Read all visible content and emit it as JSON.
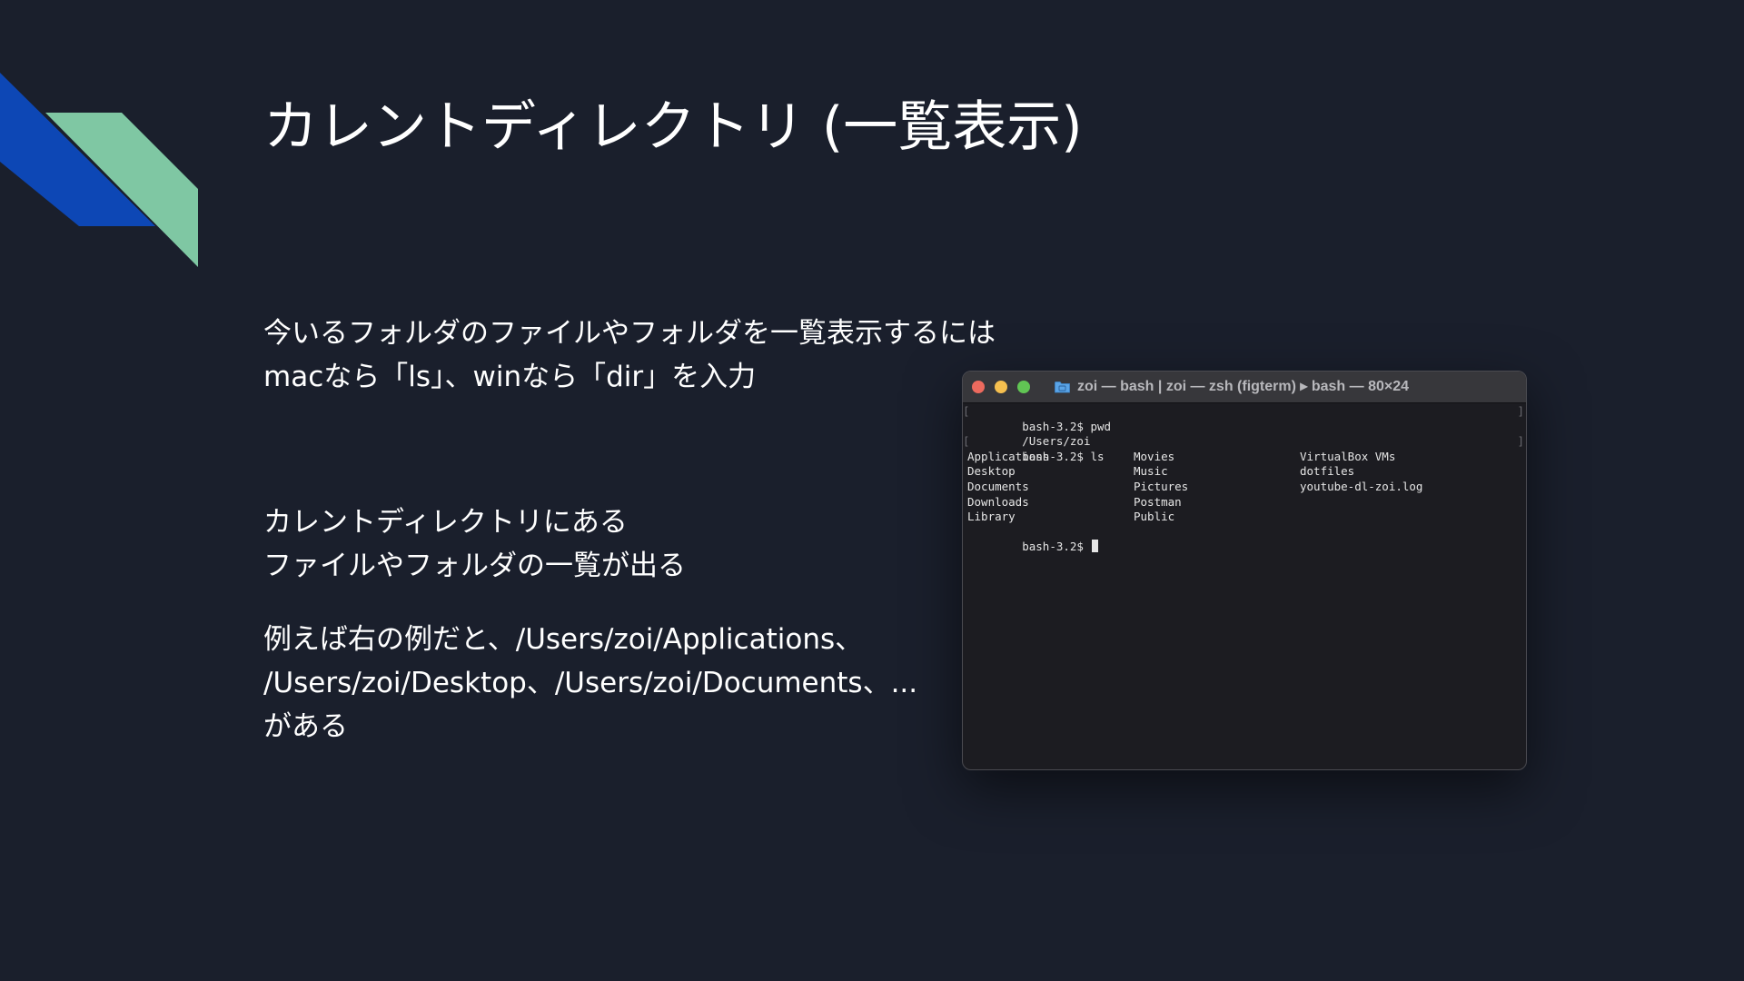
{
  "slide": {
    "title": "カレントディレクトリ (一覧表示)",
    "paragraph1": [
      "今いるフォルダのファイルやフォルダを一覧表示するには",
      "macなら「ls」、winなら「dir」を入力"
    ],
    "paragraph2": [
      "カレントディレクトリにある",
      "ファイルやフォルダの一覧が出る"
    ],
    "paragraph3": [
      "例えば右の例だと、/Users/zoi/Applications、",
      "/Users/zoi/Desktop、/Users/zoi/Documents、...",
      "がある"
    ],
    "colors": {
      "background": "#1a1f2c",
      "accent_blue": "#0d47b5",
      "accent_green": "#7fc7a3"
    }
  },
  "terminal": {
    "window_title": "zoi — bash | zoi — zsh (figterm) ▸ bash — 80×24",
    "icons": [
      "folder-icon"
    ],
    "lines": [
      "bash-3.2$ pwd",
      "/Users/zoi",
      "bash-3.2$ ls"
    ],
    "listing": [
      [
        "Applications",
        "Movies",
        "VirtualBox VMs"
      ],
      [
        "Desktop",
        "Music",
        "dotfiles"
      ],
      [
        "Documents",
        "Pictures",
        "youtube-dl-zoi.log"
      ],
      [
        "Downloads",
        "Postman",
        ""
      ],
      [
        "Library",
        "Public",
        ""
      ]
    ],
    "prompt": "bash-3.2$ "
  }
}
